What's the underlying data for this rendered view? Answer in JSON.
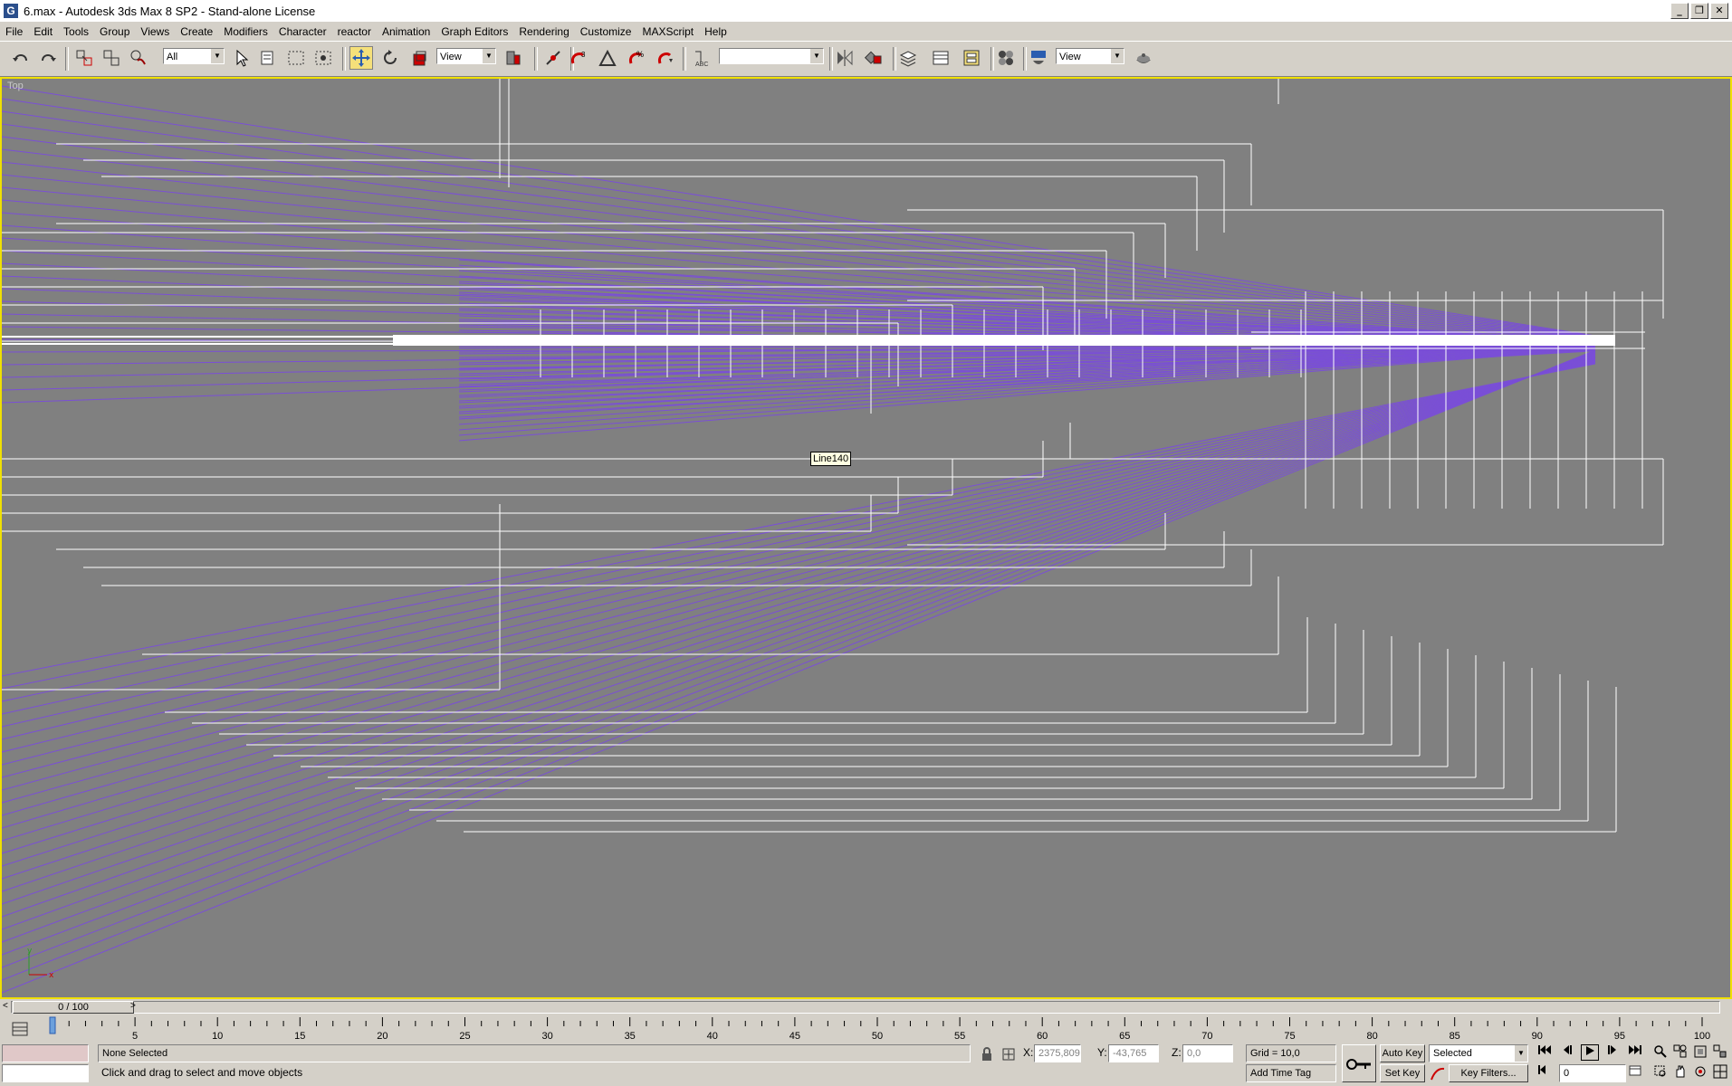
{
  "window": {
    "title": "6.max - Autodesk 3ds Max 8 SP2  - Stand-alone License",
    "app_icon": "3ds-max-icon",
    "controls": {
      "minimize": "_",
      "restore": "❐",
      "close": "✕"
    }
  },
  "menu": [
    "File",
    "Edit",
    "Tools",
    "Group",
    "Views",
    "Create",
    "Modifiers",
    "Character",
    "reactor",
    "Animation",
    "Graph Editors",
    "Rendering",
    "Customize",
    "MAXScript",
    "Help"
  ],
  "toolbar": {
    "selection_filter": "All",
    "reference_coord": "View",
    "named_selection": "",
    "render_type": "View",
    "active_tool": "select-and-move-icon"
  },
  "viewport": {
    "label": "Top",
    "tooltip": "Line140",
    "background": "#808080",
    "active_border": "#f0e000",
    "spline_color": "#7a4fd6"
  },
  "timeslider": {
    "frame": "0 / 100",
    "prev": "<",
    "next": ">"
  },
  "trackbar": {
    "ticks": [
      "5",
      "10",
      "15",
      "20",
      "25",
      "30",
      "35",
      "40",
      "45",
      "50",
      "55",
      "60",
      "65",
      "70",
      "75",
      "80",
      "85",
      "90",
      "95",
      "100"
    ]
  },
  "status": {
    "selection": "None Selected",
    "prompt": "Click and drag to select and move objects",
    "x_label": "X:",
    "x_value": "2375,809",
    "y_label": "Y:",
    "y_value": "-43,765",
    "z_label": "Z:",
    "z_value": "0,0",
    "grid": "Grid = 10,0",
    "add_time_tag": "Add Time Tag",
    "auto_key": "Auto Key",
    "set_key": "Set Key",
    "key_mode": "Selected",
    "key_filters": "Key Filters...",
    "current_frame": "0"
  }
}
